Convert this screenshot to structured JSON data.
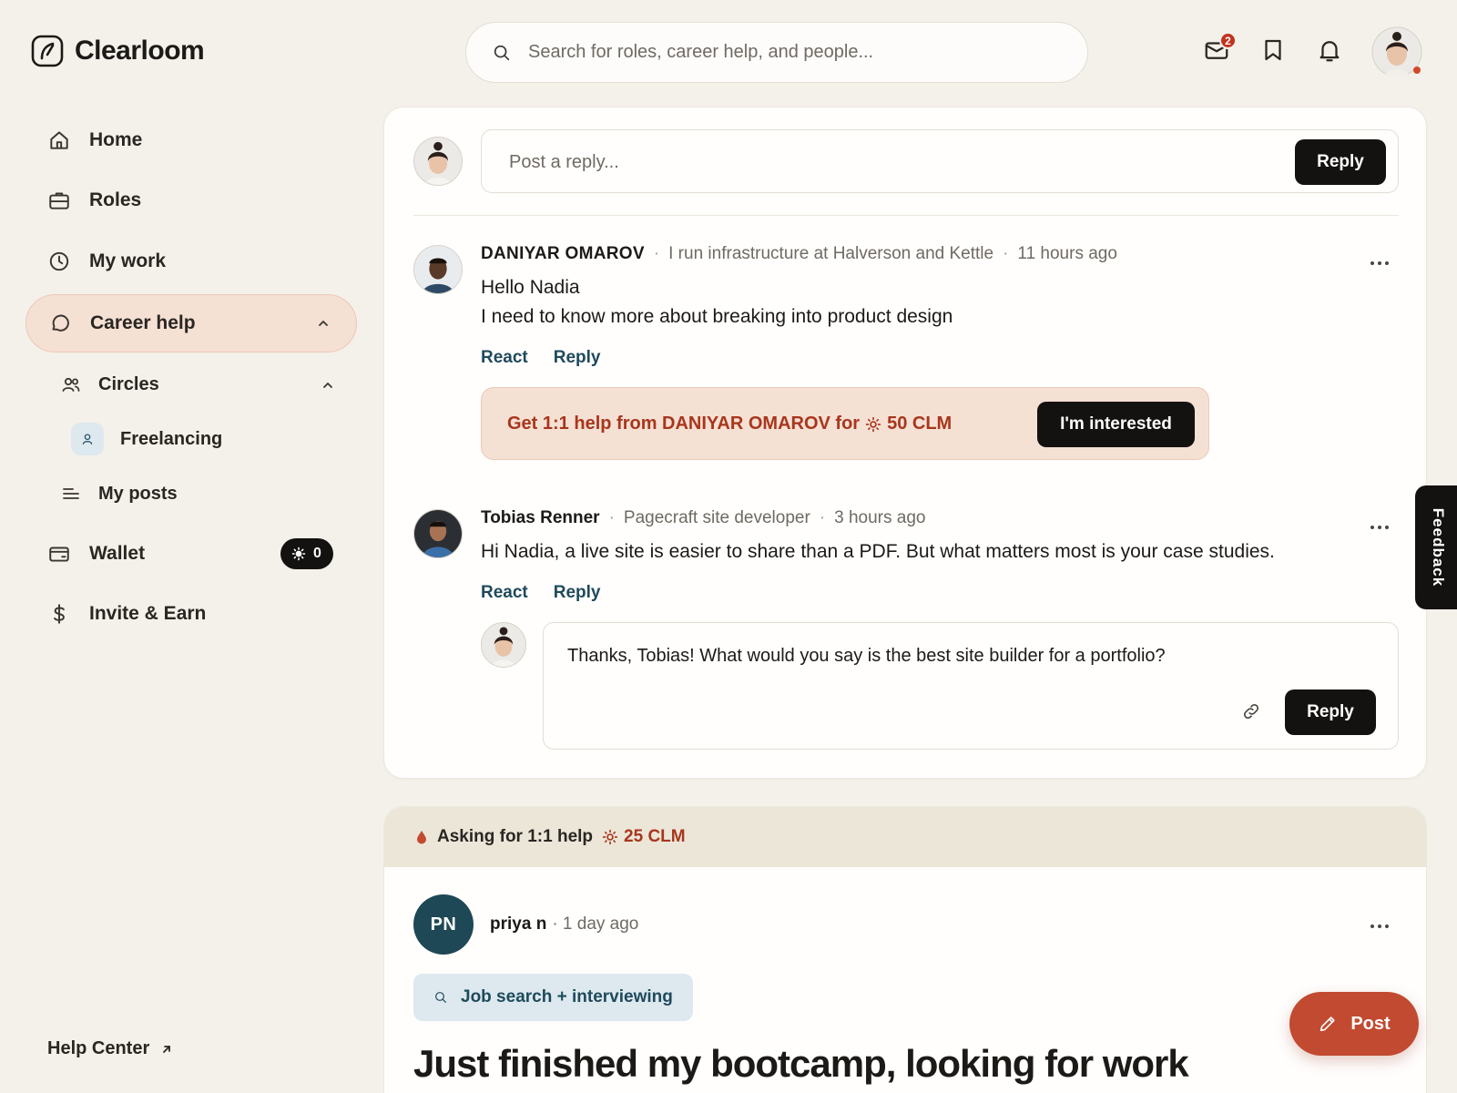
{
  "brand": {
    "name": "Clearloom"
  },
  "search": {
    "placeholder": "Search for roles, career help, and people..."
  },
  "topbar": {
    "mail_count": "2"
  },
  "sidebar": {
    "items": [
      {
        "label": "Home",
        "icon": "home-icon"
      },
      {
        "label": "Roles",
        "icon": "briefcase-icon"
      },
      {
        "label": "My work",
        "icon": "clock-icon"
      },
      {
        "label": "Career help",
        "icon": "chat-bubble-icon"
      },
      {
        "label": "Circles",
        "icon": "people-icon"
      },
      {
        "label": "Freelancing",
        "icon": "person-icon"
      },
      {
        "label": "My posts",
        "icon": "list-icon"
      },
      {
        "label": "Wallet",
        "icon": "wallet-icon",
        "badge": "0"
      },
      {
        "label": "Invite & Earn",
        "icon": "dollar-icon"
      }
    ],
    "help_center": "Help Center"
  },
  "thread": {
    "reply_placeholder": "Post a reply...",
    "reply_button": "Reply",
    "comments": [
      {
        "author": "DANIYAR OMAROV",
        "headline": "I run infrastructure at Halverson and Kettle",
        "time": "11 hours ago",
        "lines": [
          "Hello Nadia",
          "I need to know more about breaking into product design"
        ],
        "react": "React",
        "reply": "Reply",
        "offer": {
          "prefix": "Get 1:1 help from DANIYAR OMAROV for",
          "amount": "50 CLM",
          "button": "I'm interested"
        }
      },
      {
        "author": "Tobias Renner",
        "headline": "Pagecraft site developer",
        "time": "3 hours ago",
        "lines": [
          "Hi Nadia, a live site is easier to share than a PDF. But what matters most is your case studies."
        ],
        "react": "React",
        "reply": "Reply"
      }
    ],
    "nested_reply": {
      "text": "Thanks, Tobias! What would you say is the best site builder for a portfolio?",
      "button": "Reply"
    }
  },
  "feedback": {
    "label": "Feedback"
  },
  "post": {
    "header_label": "Asking for 1:1 help",
    "header_amount": "25 CLM",
    "author_initials": "PN",
    "author": "priya n",
    "time": "· 1 day ago",
    "tag": "Job search + interviewing",
    "title": "Just finished my bootcamp, looking for work"
  },
  "fab": {
    "label": "Post"
  },
  "colors": {
    "background": "#f4f1ea",
    "accent": "#c24a30",
    "offer_text": "#a8361c",
    "link": "#1f4a5c",
    "active_nav": "#f5e0d4"
  }
}
